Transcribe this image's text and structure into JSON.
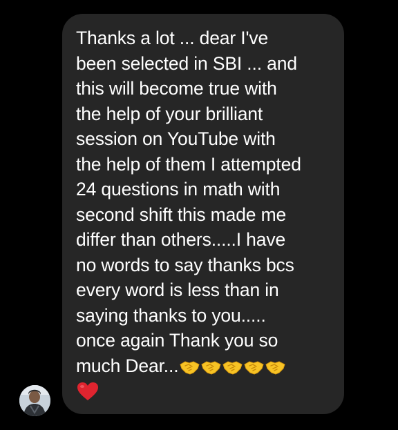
{
  "message": {
    "lines": [
      "Thanks a lot ... dear I've",
      "been selected in SBI ... and",
      "this will become true with",
      "the help of your brilliant",
      "session on YouTube with",
      "the help of them I attempted",
      "24 questions in math with",
      "second shift this made me",
      "differ than others.....I have",
      "no words to say thanks bcs",
      "every word is less than in",
      "saying thanks to you.....",
      "once again Thank you so",
      "much Dear..."
    ],
    "emojis": [
      "handshake-emoji",
      "handshake-emoji",
      "handshake-emoji",
      "handshake-emoji",
      "handshake-emoji",
      "red-heart-emoji"
    ]
  },
  "colors": {
    "background": "#000000",
    "bubble": "#262626",
    "text": "#ffffff",
    "emoji_yellow": "#f7c325",
    "heart_red": "#e0242f"
  }
}
